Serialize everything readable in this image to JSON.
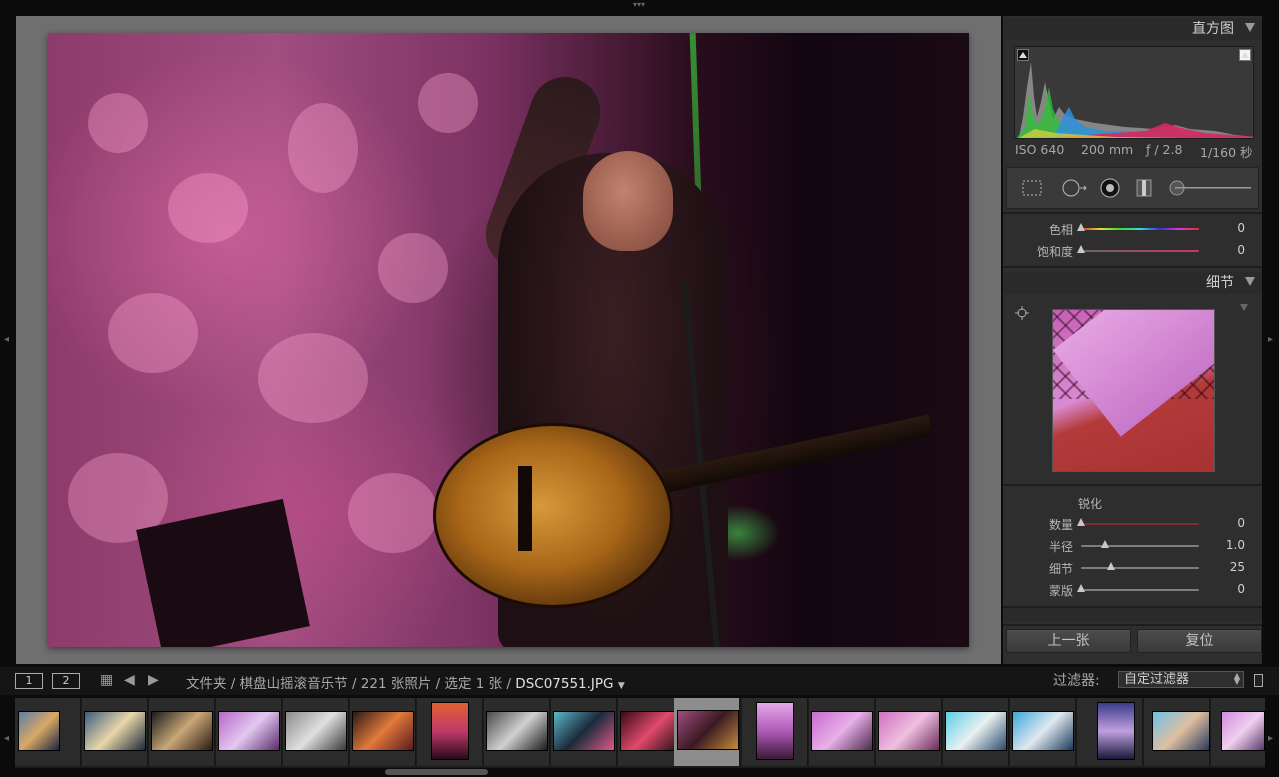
{
  "histogram_panel": {
    "title": "直方图",
    "exif": {
      "iso": "ISO 640",
      "focal": "200 mm",
      "aperture": "ƒ / 2.8",
      "shutter": "1/160 秒"
    }
  },
  "hsl_panel": {
    "sliders": [
      {
        "label": "色相",
        "value": "0",
        "fraction": 0.0
      },
      {
        "label": "饱和度",
        "value": "0",
        "fraction": 0.0
      }
    ]
  },
  "detail_panel": {
    "title": "细节",
    "sharpening_title": "锐化",
    "sliders": [
      {
        "label": "数量",
        "value": "0",
        "fraction": 0.0
      },
      {
        "label": "半径",
        "value": "1.0",
        "fraction": 0.2
      },
      {
        "label": "细节",
        "value": "25",
        "fraction": 0.25
      },
      {
        "label": "蒙版",
        "value": "0",
        "fraction": 0.0
      }
    ]
  },
  "buttons": {
    "previous": "上一张",
    "reset": "复位"
  },
  "toolbar": {
    "view1": "1",
    "view2": "2",
    "folder": "文件夹",
    "collection": "棋盘山摇滚音乐节",
    "count": "221 张照片",
    "selected": "选定 1 张",
    "filename": "DSC07551.JPG",
    "filter_label": "过滤器:",
    "filter_value": "自定过滤器"
  },
  "colors": {
    "hue_track": "#b44fb4",
    "saturation_track": "#7a7a7a",
    "sharpen_track": "#9a3a3a",
    "neutral_track": "#7d7d7d"
  }
}
